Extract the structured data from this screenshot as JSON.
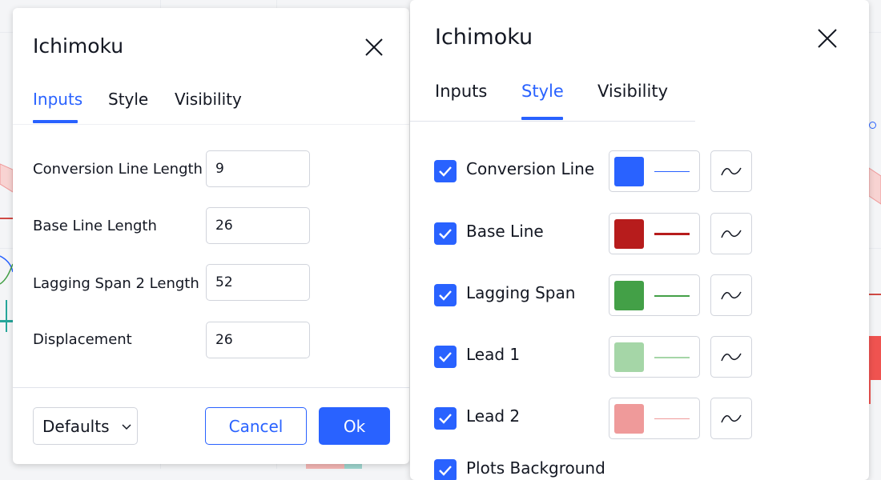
{
  "left_dialog": {
    "title": "Ichimoku",
    "tabs": [
      {
        "label": "Inputs",
        "active": true
      },
      {
        "label": "Style",
        "active": false
      },
      {
        "label": "Visibility",
        "active": false
      }
    ],
    "inputs": [
      {
        "label": "Conversion Line Length",
        "value": "9"
      },
      {
        "label": "Base Line Length",
        "value": "26"
      },
      {
        "label": "Lagging Span 2 Length",
        "value": "52"
      },
      {
        "label": "Displacement",
        "value": "26"
      }
    ],
    "footer": {
      "defaults_label": "Defaults",
      "cancel_label": "Cancel",
      "ok_label": "Ok"
    }
  },
  "right_dialog": {
    "title": "Ichimoku",
    "tabs": [
      {
        "label": "Inputs",
        "active": false
      },
      {
        "label": "Style",
        "active": true
      },
      {
        "label": "Visibility",
        "active": false
      }
    ],
    "style_rows": [
      {
        "label": "Conversion Line",
        "checked": true,
        "color": "#2962ff",
        "line_color": "#2962ff"
      },
      {
        "label": "Base Line",
        "checked": true,
        "color": "#b71c1c",
        "line_color": "#b71c1c"
      },
      {
        "label": "Lagging Span",
        "checked": true,
        "color": "#43a047",
        "line_color": "#43a047"
      },
      {
        "label": "Lead 1",
        "checked": true,
        "color": "#a5d6a7",
        "line_color": "#a5d6a7"
      },
      {
        "label": "Lead 2",
        "checked": true,
        "color": "#ef9a9a",
        "line_color": "#ef9a9a"
      },
      {
        "label": "Plots Background",
        "checked": true
      }
    ]
  },
  "icons": {
    "close": "close-icon",
    "chevron": "chevron-down-icon",
    "check": "checkmark-icon",
    "plot_shape": "wave-line-icon"
  },
  "colors": {
    "accent": "#2962ff",
    "border": "#d1d4dc",
    "text": "#131722"
  }
}
